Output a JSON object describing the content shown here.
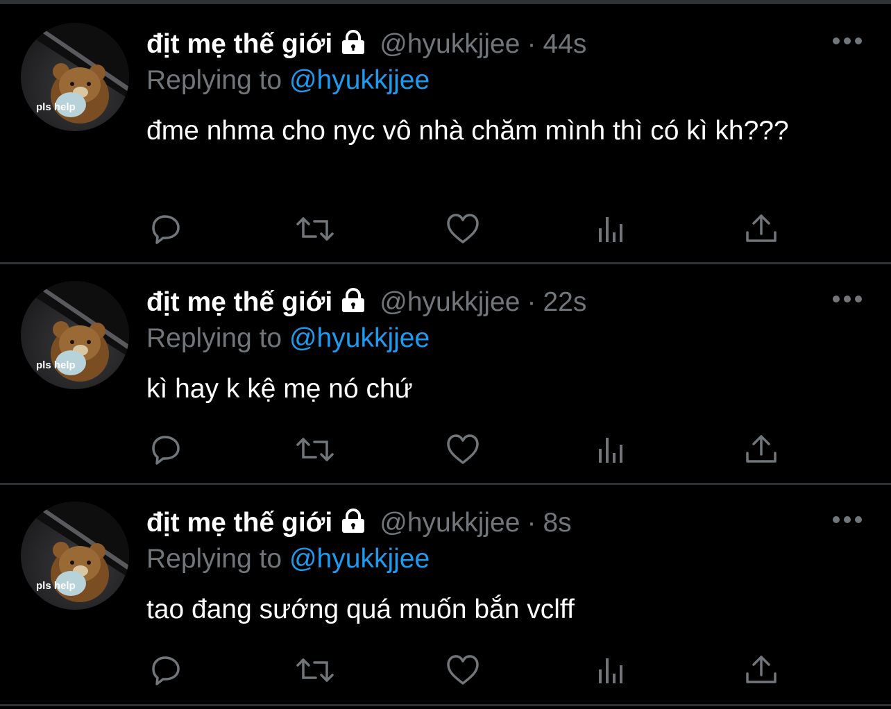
{
  "colors": {
    "background": "#000000",
    "divider": "#2f3336",
    "name": "#ffffff",
    "muted": "#71767b",
    "link": "#1d9bf0",
    "text": "#ffffff"
  },
  "tweets": [
    {
      "display_name": "địt mẹ thế giới",
      "handle": "@hyukkjjee",
      "separator": "·",
      "time": "44s",
      "replying_prefix": "Replying to",
      "replying_to": "@hyukkjjee",
      "text": "đme nhma cho nyc vô nhà chăm mình thì có kì kh???",
      "avatar_caption": "pls help"
    },
    {
      "display_name": "địt mẹ thế giới",
      "handle": "@hyukkjjee",
      "separator": "·",
      "time": "22s",
      "replying_prefix": "Replying to",
      "replying_to": "@hyukkjjee",
      "text": "kì hay k kệ mẹ nó chứ",
      "avatar_caption": "pls help"
    },
    {
      "display_name": "địt mẹ thế giới",
      "handle": "@hyukkjjee",
      "separator": "·",
      "time": "8s",
      "replying_prefix": "Replying to",
      "replying_to": "@hyukkjjee",
      "text": "tao đang sướng quá muốn bắn vclff",
      "avatar_caption": "pls help"
    }
  ],
  "icons": {
    "lock": "lock-icon",
    "more": "more-icon",
    "reply": "reply-icon",
    "retweet": "retweet-icon",
    "like": "heart-icon",
    "views": "views-icon",
    "share": "share-icon"
  }
}
